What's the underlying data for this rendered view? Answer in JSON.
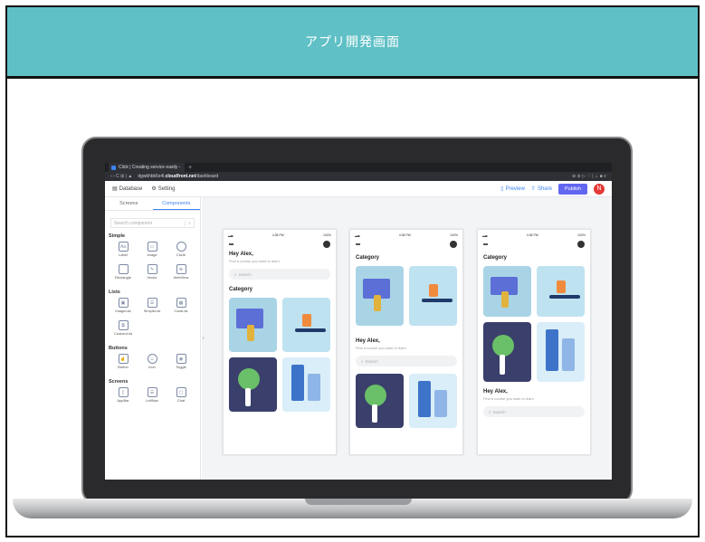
{
  "banner": {
    "title": "アプリ開発画面"
  },
  "browser": {
    "tab_title": "Click | Creating service easily -",
    "tab_plus": "+",
    "nav": "‹  ›  C  ⊞  |  ▲",
    "url_prefix": "dgwkhbk6s4l.",
    "url_domain": "cloudfront.net",
    "url_path": "/dashboard",
    "right_icons": "⊕ ⊛ ▷ ♡ | ⊥ ■ ≡"
  },
  "header": {
    "database": "Database",
    "setting": "Setting",
    "preview": "Preview",
    "share": "Share",
    "publish": "Publish",
    "avatar_initial": "N"
  },
  "sidebar": {
    "tab_screens": "Screens",
    "tab_components": "Components",
    "search_placeholder": "Search component",
    "simple_title": "Simple",
    "simple": [
      "Label",
      "Image",
      "Circle",
      "Rectangle",
      "Vector",
      "WebView"
    ],
    "lists_title": "Lists",
    "lists": [
      "ImageList",
      "SimpleList",
      "CardList",
      "CustomList"
    ],
    "buttons_title": "Buttons",
    "buttons": [
      "Button",
      "Icon",
      "Toggle"
    ],
    "screens_title": "Screens",
    "screens": [
      "AppBar",
      "LeftNav",
      "Chat"
    ]
  },
  "phones": [
    {
      "time": "4:38 PM",
      "battery": "100%",
      "hey": "Hey Alex,",
      "sub": "Find a course you want to learn",
      "search": "Search",
      "category": "Category"
    },
    {
      "time": "4:38 PM",
      "battery": "100%",
      "hey": "Hey Alex,",
      "sub": "Find a course you want to learn",
      "search": "Search",
      "category": "Category"
    },
    {
      "time": "4:38 PM",
      "battery": "100%",
      "hey": "Hey Alex,",
      "sub": "Find a course you want to learn",
      "search": "Search",
      "category": "Category"
    }
  ]
}
